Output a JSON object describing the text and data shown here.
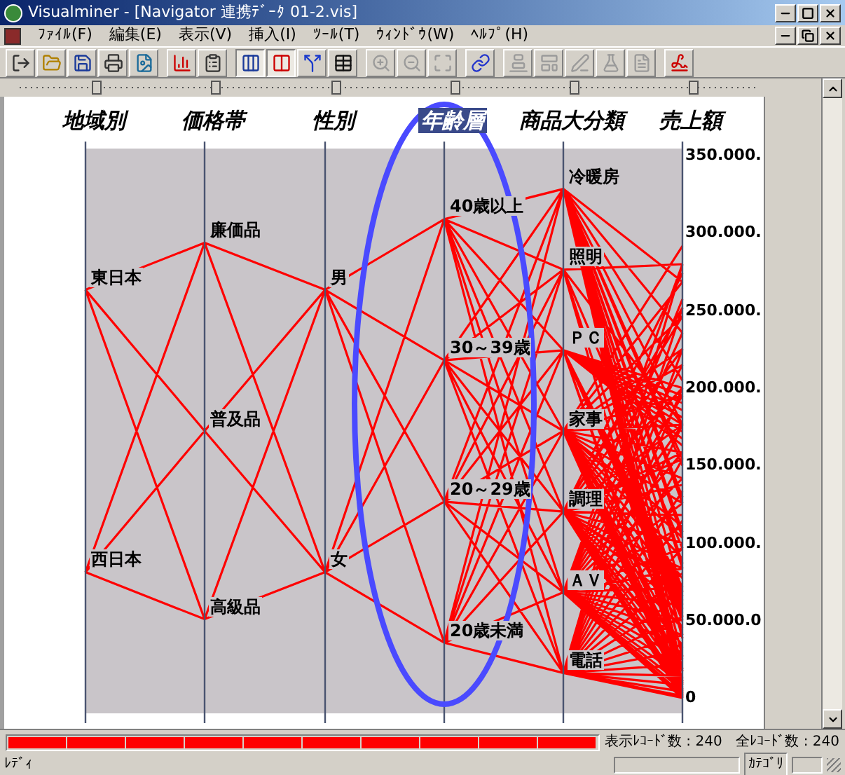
{
  "window": {
    "title": "Visualminer - [Navigator 連携ﾃﾞｰﾀ 01-2.vis]"
  },
  "menu": [
    "ﾌｧｲﾙ(F)",
    "編集(E)",
    "表示(V)",
    "挿入(I)",
    "ﾂｰﾙ(T)",
    "ｳｨﾝﾄﾞｳ(W)",
    "ﾍﾙﾌﾟ(H)"
  ],
  "toolbar": [
    [
      {
        "kind": "exit",
        "disabled": false,
        "pressed": false
      },
      {
        "kind": "open",
        "disabled": false,
        "pressed": false
      },
      {
        "kind": "save",
        "disabled": false,
        "pressed": false
      },
      {
        "kind": "print",
        "disabled": false,
        "pressed": false
      },
      {
        "kind": "image",
        "disabled": false,
        "pressed": false
      }
    ],
    [
      {
        "kind": "bars",
        "disabled": false,
        "pressed": false
      },
      {
        "kind": "properties",
        "disabled": false,
        "pressed": false
      }
    ],
    [
      {
        "kind": "columns",
        "disabled": false,
        "pressed": true
      },
      {
        "kind": "columns-color",
        "disabled": false,
        "pressed": true
      },
      {
        "kind": "split",
        "disabled": false,
        "pressed": false
      },
      {
        "kind": "table",
        "disabled": false,
        "pressed": false
      }
    ],
    [
      {
        "kind": "zoom-in",
        "disabled": true,
        "pressed": false
      },
      {
        "kind": "zoom-out",
        "disabled": true,
        "pressed": false
      },
      {
        "kind": "zoom-fit",
        "disabled": true,
        "pressed": false
      }
    ],
    [
      {
        "kind": "link",
        "disabled": false,
        "pressed": false
      }
    ],
    [
      {
        "kind": "chart",
        "disabled": true,
        "pressed": false
      },
      {
        "kind": "form",
        "disabled": true,
        "pressed": false
      },
      {
        "kind": "pen",
        "disabled": true,
        "pressed": false
      },
      {
        "kind": "flask",
        "disabled": true,
        "pressed": false
      },
      {
        "kind": "file",
        "disabled": true,
        "pressed": false
      }
    ],
    [
      {
        "kind": "signature",
        "disabled": false,
        "pressed": false
      }
    ]
  ],
  "axes": [
    {
      "title": "地域別",
      "selected": false,
      "categories": [
        "東日本",
        "西日本"
      ]
    },
    {
      "title": "価格帯",
      "selected": false,
      "categories": [
        "廉価品",
        "普及品",
        "高級品"
      ]
    },
    {
      "title": "性別",
      "selected": false,
      "categories": [
        "男",
        "女"
      ]
    },
    {
      "title": "年齢層",
      "selected": true,
      "categories": [
        "40歳以上",
        "30～39歳",
        "20～29歳",
        "20歳未満"
      ]
    },
    {
      "title": "商品大分類",
      "selected": false,
      "categories": [
        "冷暖房",
        "照明",
        "ＰＣ",
        "家事",
        "調理",
        "ＡＶ",
        "電話"
      ]
    },
    {
      "title": "売上額",
      "selected": false,
      "ticks": [
        "350.000.",
        "300.000.",
        "250.000.",
        "200.000.",
        "150.000.",
        "100.000.",
        "50.000.0",
        "0"
      ]
    }
  ],
  "progress": {
    "level": 1,
    "shown": "表示ﾚｺｰﾄﾞ数 : 240",
    "total": "全ﾚｺｰﾄﾞ数 : 240"
  },
  "status_bar": {
    "message": "ﾚﾃﾞｨ",
    "panel": "ｶﾃｺﾞﾘ"
  }
}
